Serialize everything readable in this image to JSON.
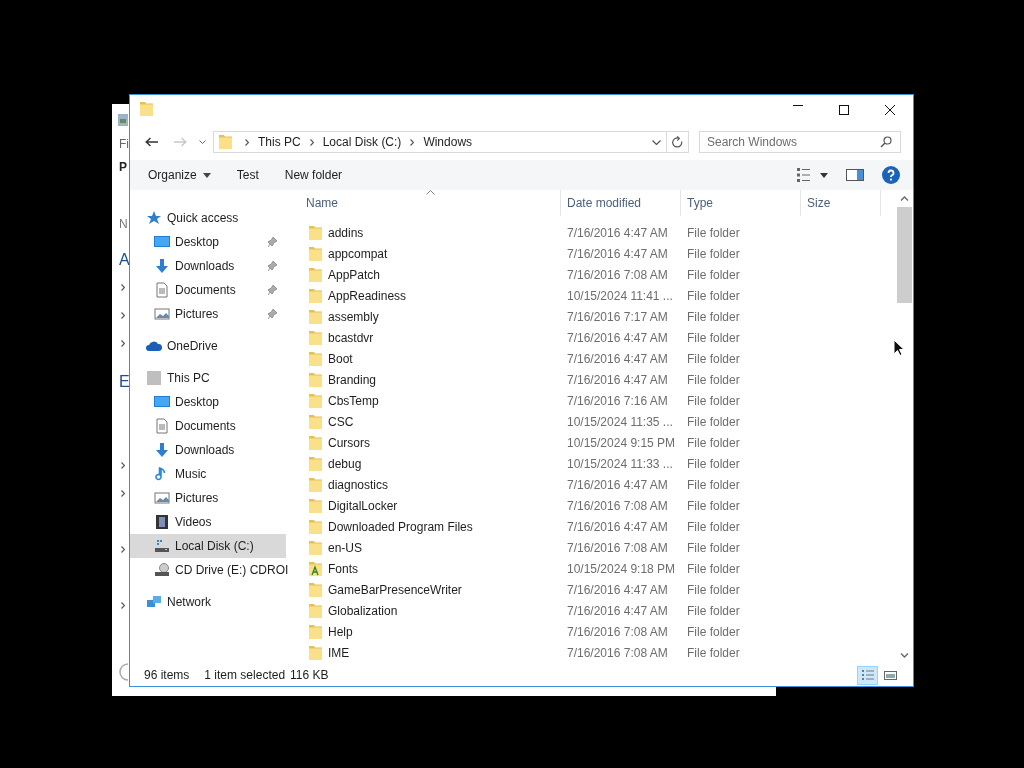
{
  "background_window": {
    "fragments": [
      {
        "text": "Fi",
        "kind": "menu"
      },
      {
        "text": "P",
        "kind": "tab"
      },
      {
        "text": "N",
        "kind": "header"
      },
      {
        "text": "A",
        "kind": "section"
      },
      {
        "text": "E",
        "kind": "section"
      }
    ]
  },
  "navigation": {
    "back": {
      "disabled": false
    },
    "forward": {
      "disabled": true
    }
  },
  "address": {
    "segments": [
      "This PC",
      "Local Disk (C:)",
      "Windows"
    ]
  },
  "search": {
    "placeholder": "Search Windows"
  },
  "toolbar": {
    "items": [
      {
        "label": "Organize",
        "dropdown": true
      },
      {
        "label": "Test",
        "dropdown": false
      },
      {
        "label": "New folder",
        "dropdown": false
      }
    ]
  },
  "nav_pane": {
    "items": [
      {
        "label": "Quick access",
        "kind": "star",
        "selected": false,
        "children": [
          {
            "label": "Desktop",
            "kind": "desktop",
            "pinned": true,
            "selected": false
          },
          {
            "label": "Downloads",
            "kind": "download",
            "pinned": true,
            "selected": false
          },
          {
            "label": "Documents",
            "kind": "document",
            "pinned": true,
            "selected": false
          },
          {
            "label": "Pictures",
            "kind": "picture",
            "pinned": true,
            "selected": false
          }
        ]
      },
      {
        "label": "OneDrive",
        "kind": "cloud",
        "selected": false
      },
      {
        "label": "This PC",
        "kind": "pc",
        "selected": false,
        "children": [
          {
            "label": "Desktop",
            "kind": "desktop",
            "pinned": false,
            "selected": false
          },
          {
            "label": "Documents",
            "kind": "document",
            "pinned": false,
            "selected": false
          },
          {
            "label": "Downloads",
            "kind": "download",
            "pinned": false,
            "selected": false
          },
          {
            "label": "Music",
            "kind": "music",
            "pinned": false,
            "selected": false
          },
          {
            "label": "Pictures",
            "kind": "picture",
            "pinned": false,
            "selected": false
          },
          {
            "label": "Videos",
            "kind": "video",
            "pinned": false,
            "selected": false
          },
          {
            "label": "Local Disk (C:)",
            "kind": "disk",
            "pinned": false,
            "selected": true
          },
          {
            "label": "CD Drive (E:) CDROI",
            "kind": "cd",
            "pinned": false,
            "selected": false
          }
        ]
      },
      {
        "label": "Network",
        "kind": "network",
        "selected": false
      }
    ]
  },
  "table": {
    "columns": [
      {
        "label": "Name",
        "sorted": true
      },
      {
        "label": "Date modified",
        "sorted": false
      },
      {
        "label": "Type",
        "sorted": false
      },
      {
        "label": "Size",
        "sorted": false
      }
    ],
    "rows": [
      {
        "name": "addins",
        "date": "7/16/2016 4:47 AM",
        "type": "File folder",
        "kind": "folder"
      },
      {
        "name": "appcompat",
        "date": "7/16/2016 4:47 AM",
        "type": "File folder",
        "kind": "folder"
      },
      {
        "name": "AppPatch",
        "date": "7/16/2016 7:08 AM",
        "type": "File folder",
        "kind": "folder"
      },
      {
        "name": "AppReadiness",
        "date": "10/15/2024 11:41 ...",
        "type": "File folder",
        "kind": "folder"
      },
      {
        "name": "assembly",
        "date": "7/16/2016 7:17 AM",
        "type": "File folder",
        "kind": "folder"
      },
      {
        "name": "bcastdvr",
        "date": "7/16/2016 4:47 AM",
        "type": "File folder",
        "kind": "folder"
      },
      {
        "name": "Boot",
        "date": "7/16/2016 4:47 AM",
        "type": "File folder",
        "kind": "folder"
      },
      {
        "name": "Branding",
        "date": "7/16/2016 4:47 AM",
        "type": "File folder",
        "kind": "folder"
      },
      {
        "name": "CbsTemp",
        "date": "7/16/2016 7:16 AM",
        "type": "File folder",
        "kind": "folder"
      },
      {
        "name": "CSC",
        "date": "10/15/2024 11:35 ...",
        "type": "File folder",
        "kind": "folder"
      },
      {
        "name": "Cursors",
        "date": "10/15/2024 9:15 PM",
        "type": "File folder",
        "kind": "folder"
      },
      {
        "name": "debug",
        "date": "10/15/2024 11:33 ...",
        "type": "File folder",
        "kind": "folder"
      },
      {
        "name": "diagnostics",
        "date": "7/16/2016 4:47 AM",
        "type": "File folder",
        "kind": "folder"
      },
      {
        "name": "DigitalLocker",
        "date": "7/16/2016 7:08 AM",
        "type": "File folder",
        "kind": "folder"
      },
      {
        "name": "Downloaded Program Files",
        "date": "7/16/2016 4:47 AM",
        "type": "File folder",
        "kind": "folder"
      },
      {
        "name": "en-US",
        "date": "7/16/2016 7:08 AM",
        "type": "File folder",
        "kind": "folder"
      },
      {
        "name": "Fonts",
        "date": "10/15/2024 9:18 PM",
        "type": "File folder",
        "kind": "fonts"
      },
      {
        "name": "GameBarPresenceWriter",
        "date": "7/16/2016 4:47 AM",
        "type": "File folder",
        "kind": "folder"
      },
      {
        "name": "Globalization",
        "date": "7/16/2016 4:47 AM",
        "type": "File folder",
        "kind": "folder"
      },
      {
        "name": "Help",
        "date": "7/16/2016 7:08 AM",
        "type": "File folder",
        "kind": "folder"
      },
      {
        "name": "IME",
        "date": "7/16/2016 7:08 AM",
        "type": "File folder",
        "kind": "folder"
      }
    ]
  },
  "status_bar": {
    "item_count": "96 items",
    "selection": "1 item selected",
    "size": "116 KB"
  },
  "view_buttons": [
    {
      "kind": "details",
      "selected": true
    },
    {
      "kind": "large_icons",
      "selected": false
    }
  ]
}
